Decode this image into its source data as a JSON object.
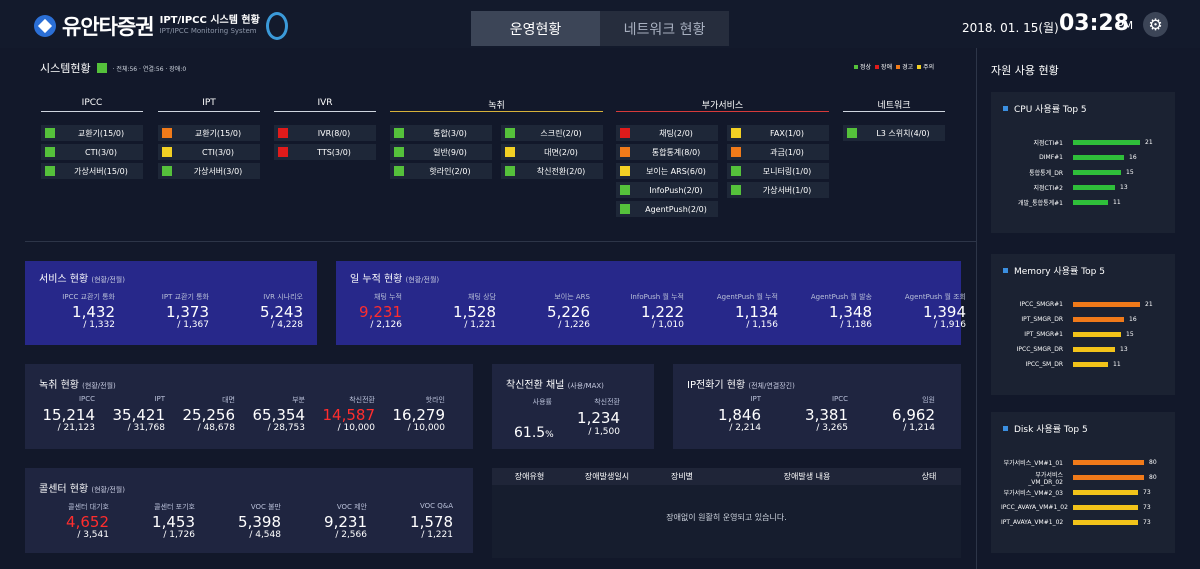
{
  "header": {
    "brand": "유안타증권",
    "sys_title": "IPT/IPCC 시스템 현황",
    "sys_sub": "IPT/IPCC Monitoring System",
    "tabs": [
      "운영현황",
      "네트워크 현황"
    ],
    "date": "2018. 01. 15(월)",
    "time": "03:28",
    "ampm": "PM"
  },
  "system": {
    "title": "시스템현황",
    "summary": "· 전체:56 · 연결:56 · 장애:0",
    "legend": [
      "정상",
      "장애",
      "경고",
      "주의"
    ],
    "status_colors": {
      "normal": "#55c13b",
      "error": "#e01b1b",
      "warning": "#f07a1a",
      "caution": "#f2d024"
    }
  },
  "groups": [
    {
      "name": "IPCC",
      "items": [
        {
          "label": "교환기(15/0)",
          "s": "normal"
        },
        {
          "label": "CTI(3/0)",
          "s": "normal"
        },
        {
          "label": "가상서버(15/0)",
          "s": "normal"
        }
      ]
    },
    {
      "name": "IPT",
      "items": [
        {
          "label": "교환기(15/0)",
          "s": "warning"
        },
        {
          "label": "CTI(3/0)",
          "s": "caution"
        },
        {
          "label": "가상서버(3/0)",
          "s": "normal"
        }
      ]
    },
    {
      "name": "IVR",
      "items": [
        {
          "label": "IVR(8/0)",
          "s": "error"
        },
        {
          "label": "TTS(3/0)",
          "s": "error"
        }
      ]
    },
    {
      "name": "녹취",
      "items": [
        {
          "label": "통합(3/0)",
          "s": "normal"
        },
        {
          "label": "스크린(2/0)",
          "s": "normal"
        },
        {
          "label": "일반(9/0)",
          "s": "normal"
        },
        {
          "label": "대면(2/0)",
          "s": "caution"
        },
        {
          "label": "핫라인(2/0)",
          "s": "normal"
        },
        {
          "label": "착신전환(2/0)",
          "s": "normal"
        }
      ]
    },
    {
      "name": "부가서비스",
      "items": [
        {
          "label": "채팅(2/0)",
          "s": "error"
        },
        {
          "label": "FAX(1/0)",
          "s": "caution"
        },
        {
          "label": "통합통계(8/0)",
          "s": "warning"
        },
        {
          "label": "과금(1/0)",
          "s": "warning"
        },
        {
          "label": "보이는 ARS(6/0)",
          "s": "caution"
        },
        {
          "label": "모니터링(1/0)",
          "s": "normal"
        },
        {
          "label": "InfoPush(2/0)",
          "s": "normal"
        },
        {
          "label": "가상서버(1/0)",
          "s": "normal"
        },
        {
          "label": "AgentPush(2/0)",
          "s": "normal"
        }
      ]
    },
    {
      "name": "네트워크",
      "items": [
        {
          "label": "L3 스위치(4/0)",
          "s": "normal"
        }
      ]
    }
  ],
  "service": {
    "title": "서비스 현황",
    "sub": "(현황/전월)",
    "metrics": [
      {
        "h": "IPCC 교환기 통화",
        "v": "1,432",
        "s": "/ 1,332"
      },
      {
        "h": "IPT 교환기 통화",
        "v": "1,373",
        "s": "/ 1,367"
      },
      {
        "h": "IVR 시나리오",
        "v": "5,243",
        "s": "/ 4,228"
      }
    ]
  },
  "daily": {
    "title": "일 누적 현황",
    "sub": "(현황/전월)",
    "metrics": [
      {
        "h": "채팅 누적",
        "v": "9,231",
        "s": "/ 2,126",
        "red": true
      },
      {
        "h": "채팅 상담",
        "v": "1,528",
        "s": "/ 1,221"
      },
      {
        "h": "보이는 ARS",
        "v": "5,226",
        "s": "/ 1,226"
      },
      {
        "h": "InfoPush 월 누적",
        "v": "1,222",
        "s": "/ 1,010"
      },
      {
        "h": "AgentPush 월 누적",
        "v": "1,134",
        "s": "/ 1,156"
      },
      {
        "h": "AgentPush 월 발송",
        "v": "1,348",
        "s": "/ 1,186"
      },
      {
        "h": "AgentPush 월 조회",
        "v": "1,394",
        "s": "/ 1,916"
      }
    ]
  },
  "rec": {
    "title": "녹취 현황",
    "sub": "(현황/전월)",
    "metrics": [
      {
        "h": "IPCC",
        "v": "15,214",
        "s": "/ 21,123"
      },
      {
        "h": "IPT",
        "v": "35,421",
        "s": "/ 31,768"
      },
      {
        "h": "대면",
        "v": "25,256",
        "s": "/ 48,678"
      },
      {
        "h": "부분",
        "v": "65,354",
        "s": "/ 28,753"
      },
      {
        "h": "착신전환",
        "v": "14,587",
        "s": "/ 10,000",
        "red": true
      },
      {
        "h": "핫라인",
        "v": "16,279",
        "s": "/ 10,000"
      }
    ]
  },
  "fwd": {
    "title": "착신전환 채널",
    "sub": "(사용/MAX)",
    "usage_h": "사용률",
    "usage_v": "61.5",
    "usage_u": "%",
    "h": "착신전환",
    "v": "1,234",
    "s": "/ 1,500"
  },
  "phones": {
    "title": "IP전화기 현황",
    "sub": "(전체/연결장긴)",
    "metrics": [
      {
        "h": "IPT",
        "v": "1,846",
        "s": "/ 2,214"
      },
      {
        "h": "IPCC",
        "v": "3,381",
        "s": "/ 3,265"
      },
      {
        "h": "임원",
        "v": "6,962",
        "s": "/ 1,214"
      }
    ]
  },
  "call": {
    "title": "콜센터 현황",
    "sub": "(현황/전월)",
    "metrics": [
      {
        "h": "콜센터 대기호",
        "v": "4,652",
        "s": "/ 3,541",
        "red": true
      },
      {
        "h": "콜센터 포기호",
        "v": "1,453",
        "s": "/ 1,726"
      },
      {
        "h": "VOC 불만",
        "v": "5,398",
        "s": "/ 4,548"
      },
      {
        "h": "VOC 제안",
        "v": "9,231",
        "s": "/ 2,566"
      },
      {
        "h": "VOC Q&A",
        "v": "1,578",
        "s": "/ 1,221"
      }
    ]
  },
  "fault": {
    "cols": [
      "장애유형",
      "장애발생일시",
      "장비별",
      "장애발생 내용",
      "상태"
    ],
    "empty": "장애없이 원활히 운영되고 있습니다."
  },
  "resource": {
    "title": "자원 사용 현황",
    "max": 25,
    "cpu": {
      "title": "CPU 사용률 Top 5",
      "rows": [
        {
          "n": "지점CTI#1",
          "v": 21,
          "c": "#2fbf3a"
        },
        {
          "n": "DIMF#1",
          "v": 16,
          "c": "#2fbf3a"
        },
        {
          "n": "통합통계_DR",
          "v": 15,
          "c": "#2fbf3a"
        },
        {
          "n": "지점CTI#2",
          "v": 13,
          "c": "#2fbf3a"
        },
        {
          "n": "개발_통합통계#1",
          "v": 11,
          "c": "#2fbf3a"
        }
      ]
    },
    "mem": {
      "title": "Memory 사용률 Top 5",
      "rows": [
        {
          "n": "IPCC_SMGR#1",
          "v": 21,
          "c": "#f07a1a"
        },
        {
          "n": "IPT_SMGR_DR",
          "v": 16,
          "c": "#f07a1a"
        },
        {
          "n": "IPT_SMGR#1",
          "v": 15,
          "c": "#f2c31a"
        },
        {
          "n": "IPCC_SMGR_DR",
          "v": 13,
          "c": "#f2c31a"
        },
        {
          "n": "IPCC_SM_DR",
          "v": 11,
          "c": "#f2c31a"
        }
      ]
    },
    "disk": {
      "title": "Disk 사용률 Top 5",
      "rows": [
        {
          "n": "부가서비스_VM#1_01",
          "v": 80,
          "c": "#f07a1a"
        },
        {
          "n": "부가서비스_VM_DR_02",
          "v": 80,
          "c": "#f07a1a"
        },
        {
          "n": "부가서비스_VM#2_03",
          "v": 73,
          "c": "#f2c31a"
        },
        {
          "n": "IPCC_AVAYA_VM#1_02",
          "v": 73,
          "c": "#f2c31a"
        },
        {
          "n": "IPT_AVAYA_VM#1_02",
          "v": 73,
          "c": "#f2c31a"
        }
      ],
      "max": 90
    }
  }
}
